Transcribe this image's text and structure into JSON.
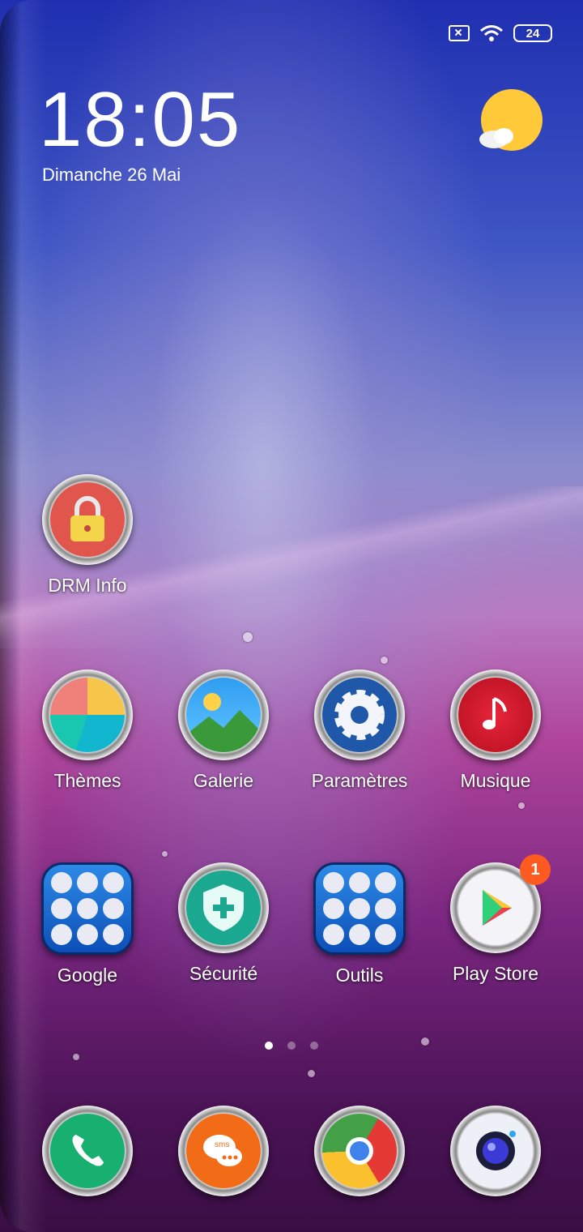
{
  "status_bar": {
    "icons": [
      "no-sim-icon",
      "wifi-icon",
      "battery-icon"
    ],
    "battery_level": "24"
  },
  "clock": {
    "time": "18:05",
    "date": "Dimanche 26 Mai",
    "weather_icon": "sun-cloud-icon"
  },
  "apps": {
    "drm": {
      "label": "DRM Info",
      "icon": "lock-icon"
    },
    "themes": {
      "label": "Thèmes",
      "icon": "themes-icon"
    },
    "gallery": {
      "label": "Galerie",
      "icon": "landscape-icon"
    },
    "settings": {
      "label": "Paramètres",
      "icon": "gear-icon"
    },
    "music": {
      "label": "Musique",
      "icon": "music-note-icon"
    },
    "google": {
      "label": "Google",
      "icon": "folder-icon"
    },
    "security": {
      "label": "Sécurité",
      "icon": "shield-icon"
    },
    "tools": {
      "label": "Outils",
      "icon": "folder-icon"
    },
    "play_store": {
      "label": "Play Store",
      "icon": "play-icon",
      "badge": "1"
    }
  },
  "dock": [
    "phone-icon",
    "sms-icon",
    "chrome-icon",
    "camera-icon"
  ],
  "dock_sms_text": "sms",
  "page_indicator": {
    "count": 3,
    "active": 0
  },
  "colors": {
    "badge": "#ff5a1f",
    "accent_blue": "#1e6fd9"
  }
}
